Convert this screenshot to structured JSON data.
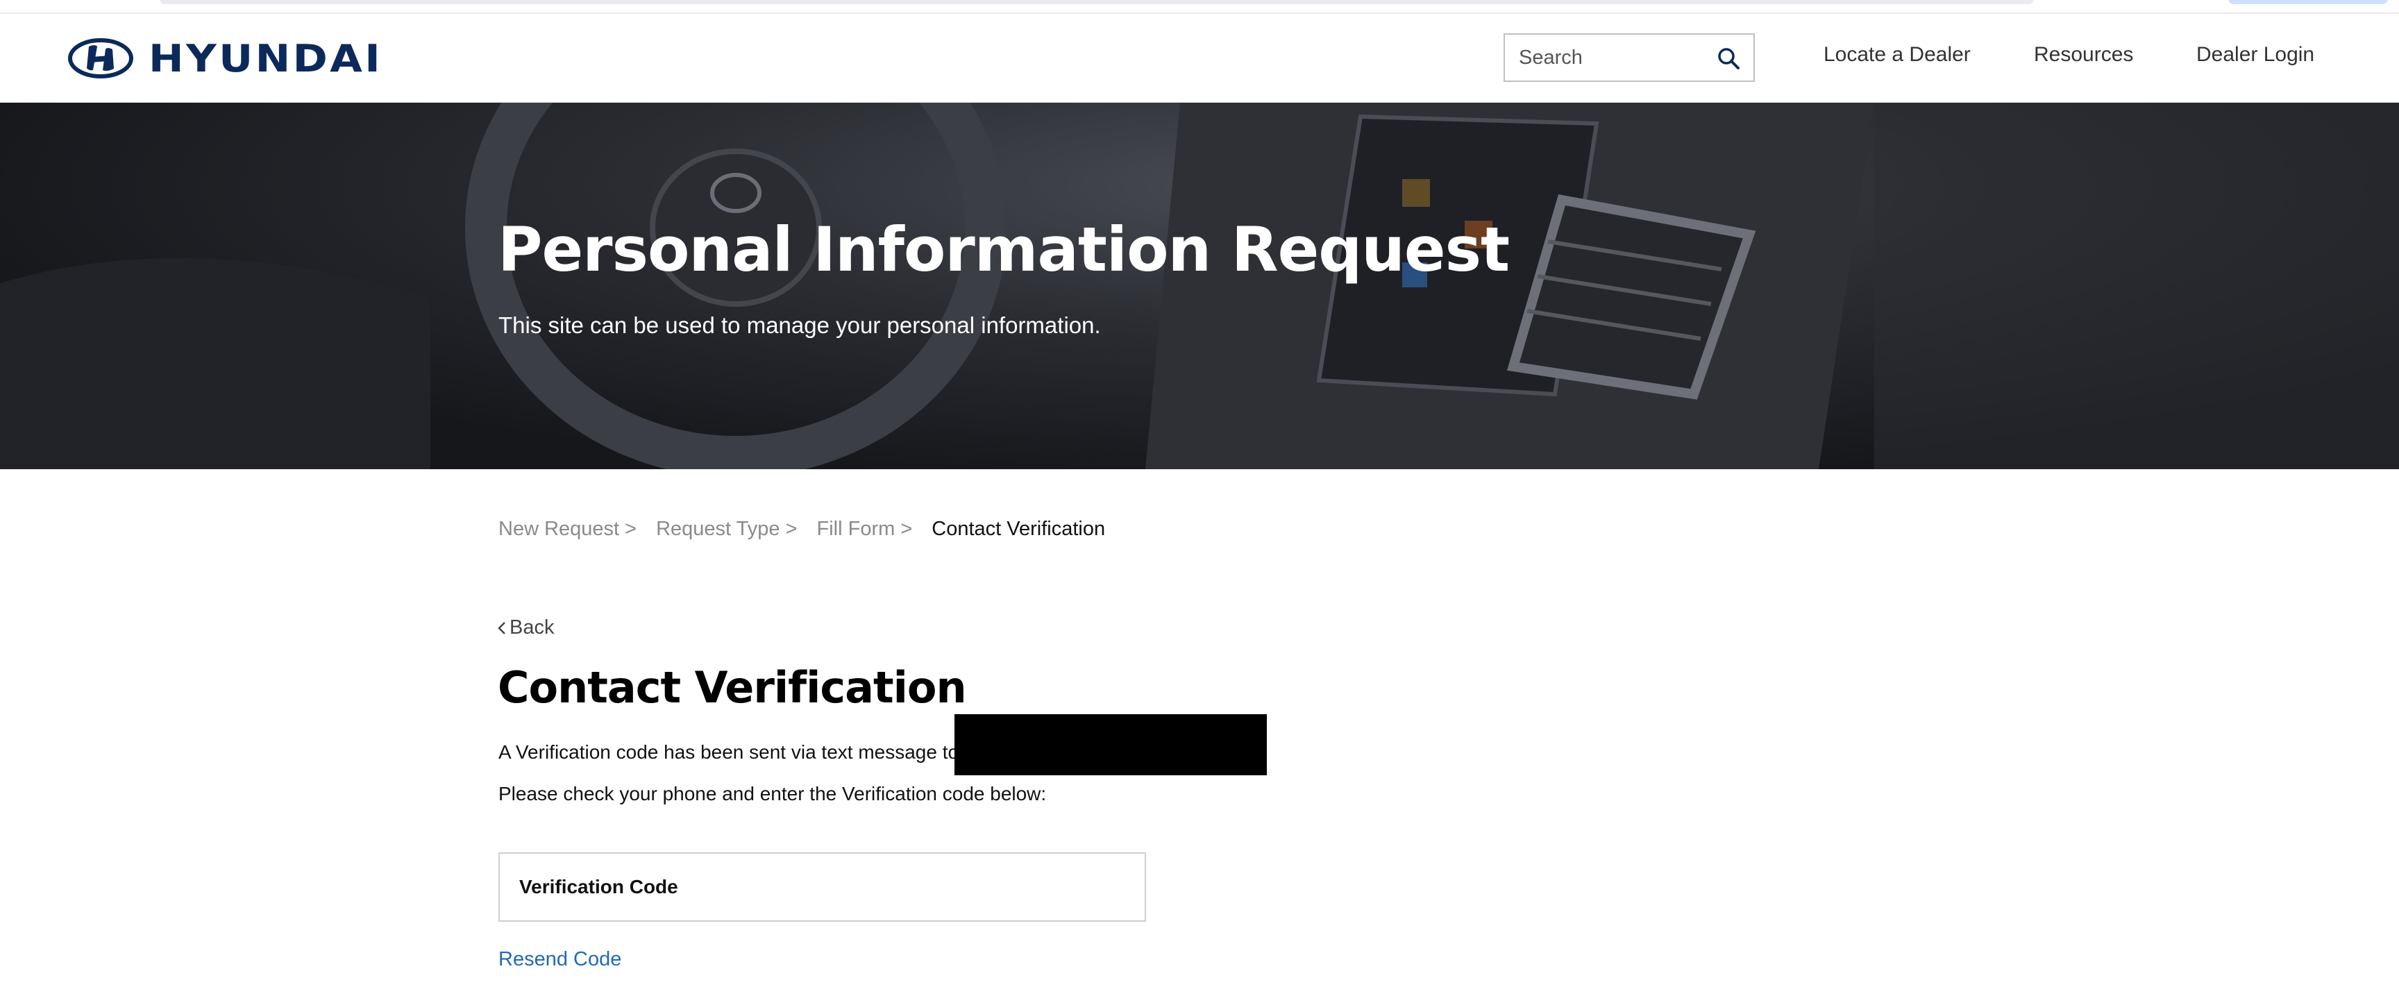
{
  "brand": {
    "name": "HYUNDAI",
    "color": "#0b2a5b"
  },
  "header": {
    "search_placeholder": "Search",
    "nav": [
      "Locate a Dealer",
      "Resources",
      "Dealer Login"
    ]
  },
  "hero": {
    "title": "Personal Information Request",
    "subtitle": "This site can be used to manage your personal information."
  },
  "breadcrumb": {
    "items": [
      "New Request  >",
      "Request Type >",
      "Fill Form >"
    ],
    "current": "Contact Verification"
  },
  "back_label": "Back",
  "section": {
    "title": "Contact Verification",
    "message_line1": "A Verification code has been sent via text message to",
    "message_line2": "Please check your phone and enter the Verification code below:",
    "code_placeholder": "Verification Code",
    "resend_label": "Resend Code"
  },
  "colors": {
    "link": "#1f6ab8",
    "breadcrumb_inactive": "#8a8a8a"
  }
}
